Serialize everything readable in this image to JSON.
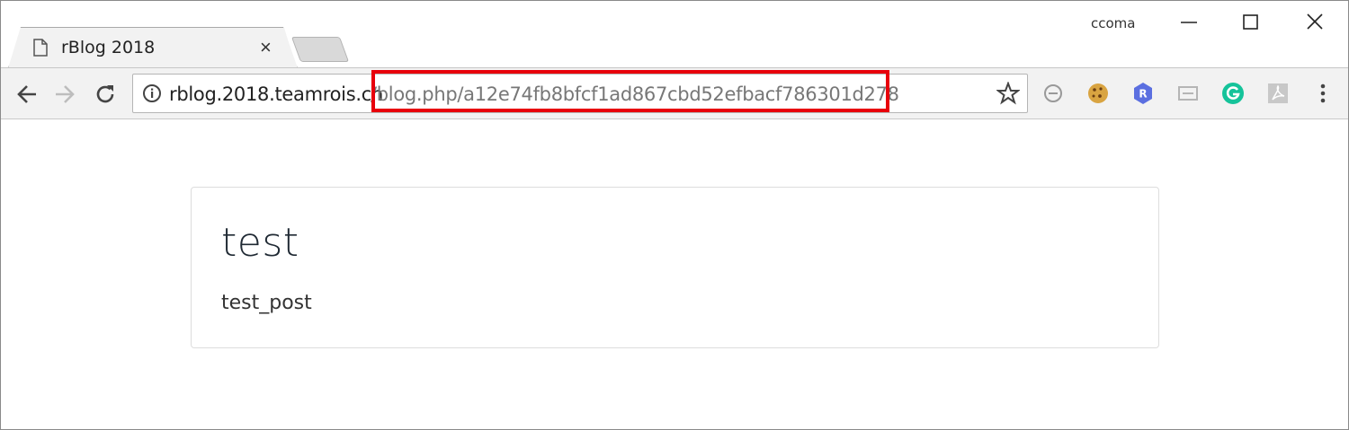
{
  "window": {
    "user_label": "ccoma"
  },
  "tab": {
    "title": "rBlog 2018",
    "close_glyph": "×"
  },
  "address_bar": {
    "host": "rblog.2018.teamrois.cn",
    "path": "/blog.php/a12e74fb8bfcf1ad867cbd52efbacf786301d278",
    "highlight_color": "#e8000b"
  },
  "extensions": [
    {
      "icon": "block-icon"
    },
    {
      "icon": "cookie-icon"
    },
    {
      "icon": "r-extension-icon",
      "letter": "R"
    },
    {
      "icon": "cast-icon"
    },
    {
      "icon": "grammarly-icon"
    },
    {
      "icon": "pdf-icon"
    }
  ],
  "post": {
    "title": "test",
    "body": "test_post"
  }
}
